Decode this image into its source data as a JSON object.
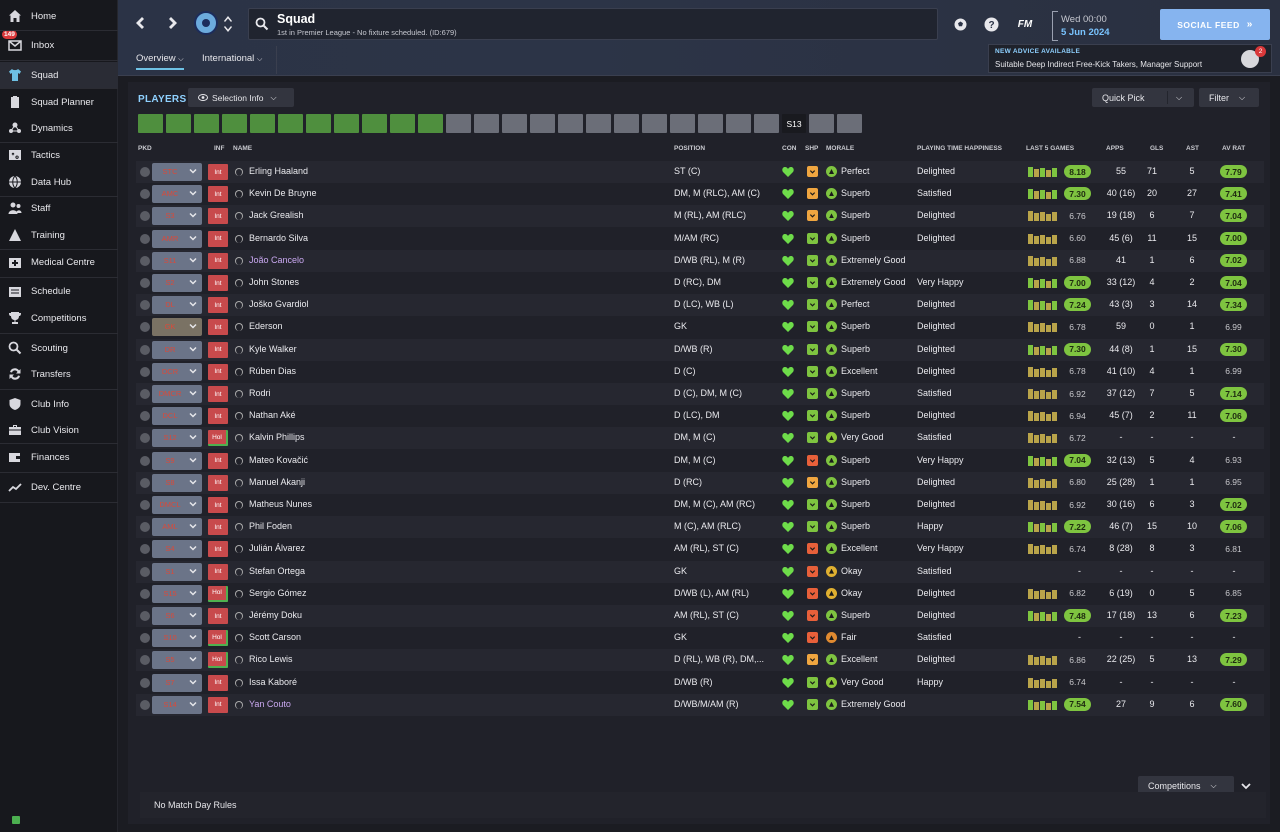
{
  "nav": {
    "items": [
      {
        "label": "Home",
        "icon": "home-icon"
      },
      {
        "label": "Inbox",
        "icon": "inbox-icon",
        "badge": "149"
      },
      {
        "label": "Squad",
        "icon": "shirt-icon",
        "active": true
      },
      {
        "label": "Squad Planner",
        "icon": "clipboard-icon"
      },
      {
        "label": "Dynamics",
        "icon": "dynamics-icon"
      },
      {
        "label": "Tactics",
        "icon": "tactics-board-icon"
      },
      {
        "label": "Data Hub",
        "icon": "globe-icon"
      },
      {
        "label": "Staff",
        "icon": "staff-icon"
      },
      {
        "label": "Training",
        "icon": "training-icon"
      },
      {
        "label": "Medical Centre",
        "icon": "medical-icon"
      },
      {
        "label": "Schedule",
        "icon": "calendar-icon"
      },
      {
        "label": "Competitions",
        "icon": "trophy-icon"
      },
      {
        "label": "Scouting",
        "icon": "search-icon"
      },
      {
        "label": "Transfers",
        "icon": "transfer-icon"
      },
      {
        "label": "Club Info",
        "icon": "shield-icon"
      },
      {
        "label": "Club Vision",
        "icon": "briefcase-icon"
      },
      {
        "label": "Finances",
        "icon": "wallet-icon"
      },
      {
        "label": "Dev. Centre",
        "icon": "development-icon"
      }
    ]
  },
  "header": {
    "title": "Squad",
    "subtitle": "1st in Premier League - No fixture scheduled. (ID:679)",
    "tabs": [
      "Overview",
      "International"
    ],
    "fm_label": "FM",
    "date_day": "Wed 00:00",
    "date_date": "5 Jun 2024",
    "social_feed": "SOCIAL FEED",
    "advice_title": "NEW ADVICE AVAILABLE",
    "advice_text": "Suitable Deep Indirect Free-Kick Takers, Manager Support",
    "advice_badge": "2"
  },
  "toolbar": {
    "players_label": "PLAYERS",
    "selection_info": "Selection Info",
    "quick_pick": "Quick Pick",
    "filter": "Filter",
    "selected_chip": "S13"
  },
  "columns": {
    "pkd": "PKD",
    "inf": "INF",
    "name": "NAME",
    "position": "POSITION",
    "con": "CON",
    "shp": "SHP",
    "morale": "MORALE",
    "pth": "PLAYING TIME HAPPINESS",
    "last5": "LAST 5 GAMES",
    "apps": "APPS",
    "gls": "GLS",
    "ast": "AST",
    "avrat": "AV RAT"
  },
  "players": [
    {
      "pkd": "STC",
      "inf": "Int",
      "name": "Erling Haaland",
      "position": "ST (C)",
      "morale": "Perfect",
      "pth": "Delighted",
      "last5": "8.18",
      "apps": "55",
      "gls": "71",
      "ast": "5",
      "avrat": "7.79"
    },
    {
      "pkd": "AMC",
      "inf": "Int",
      "name": "Kevin De Bruyne",
      "position": "DM, M (RLC), AM (C)",
      "morale": "Superb",
      "pth": "Satisfied",
      "last5": "7.30",
      "apps": "40 (16)",
      "gls": "20",
      "ast": "27",
      "avrat": "7.41"
    },
    {
      "pkd": "S3",
      "inf": "Int",
      "name": "Jack Grealish",
      "position": "M (RL), AM (RLC)",
      "morale": "Superb",
      "pth": "Delighted",
      "last5": "6.76",
      "apps": "19 (18)",
      "gls": "6",
      "ast": "7",
      "avrat": "7.04"
    },
    {
      "pkd": "AMR",
      "inf": "Int",
      "name": "Bernardo Silva",
      "position": "M/AM (RC)",
      "morale": "Superb",
      "pth": "Delighted",
      "last5": "6.60",
      "apps": "45 (6)",
      "gls": "11",
      "ast": "15",
      "avrat": "7.00"
    },
    {
      "pkd": "S11",
      "inf": "Int",
      "name": "João Cancelo",
      "position": "D/WB (RL), M (R)",
      "morale": "Extremely Good",
      "pth": "",
      "last5": "6.88",
      "apps": "41",
      "gls": "1",
      "ast": "6",
      "avrat": "7.02",
      "loan": true
    },
    {
      "pkd": "S2",
      "inf": "Int",
      "name": "John Stones",
      "position": "D (RC), DM",
      "morale": "Extremely Good",
      "pth": "Very Happy",
      "last5": "7.00",
      "apps": "33 (12)",
      "gls": "4",
      "ast": "2",
      "avrat": "7.04"
    },
    {
      "pkd": "DL",
      "inf": "Int",
      "name": "Joško Gvardiol",
      "position": "D (LC), WB (L)",
      "morale": "Perfect",
      "pth": "Delighted",
      "last5": "7.24",
      "apps": "43 (3)",
      "gls": "3",
      "ast": "14",
      "avrat": "7.34"
    },
    {
      "pkd": "GK",
      "inf": "Int",
      "name": "Ederson",
      "position": "GK",
      "morale": "Superb",
      "pth": "Delighted",
      "last5": "6.78",
      "apps": "59",
      "gls": "0",
      "ast": "1",
      "avrat": "6.99"
    },
    {
      "pkd": "DR",
      "inf": "Int",
      "name": "Kyle Walker",
      "position": "D/WB (R)",
      "morale": "Superb",
      "pth": "Delighted",
      "last5": "7.30",
      "apps": "44 (8)",
      "gls": "1",
      "ast": "15",
      "avrat": "7.30"
    },
    {
      "pkd": "DCR",
      "inf": "Int",
      "name": "Rúben Dias",
      "position": "D (C)",
      "morale": "Excellent",
      "pth": "Delighted",
      "last5": "6.78",
      "apps": "41 (10)",
      "gls": "4",
      "ast": "1",
      "avrat": "6.99"
    },
    {
      "pkd": "DMCR",
      "inf": "Int",
      "name": "Rodri",
      "position": "D (C), DM, M (C)",
      "morale": "Superb",
      "pth": "Satisfied",
      "last5": "6.92",
      "apps": "37 (12)",
      "gls": "7",
      "ast": "5",
      "avrat": "7.14"
    },
    {
      "pkd": "DCL",
      "inf": "Int",
      "name": "Nathan Aké",
      "position": "D (LC), DM",
      "morale": "Superb",
      "pth": "Delighted",
      "last5": "6.94",
      "apps": "45 (7)",
      "gls": "2",
      "ast": "11",
      "avrat": "7.06"
    },
    {
      "pkd": "S12",
      "inf": "Hol",
      "name": "Kalvin Phillips",
      "position": "DM, M (C)",
      "morale": "Very Good",
      "pth": "Satisfied",
      "last5": "6.72",
      "apps": "-",
      "gls": "-",
      "ast": "-",
      "avrat": "-"
    },
    {
      "pkd": "S9",
      "inf": "Int",
      "name": "Mateo Kovačić",
      "position": "DM, M (C)",
      "morale": "Superb",
      "pth": "Very Happy",
      "last5": "7.04",
      "apps": "32 (13)",
      "gls": "5",
      "ast": "4",
      "avrat": "6.93"
    },
    {
      "pkd": "S8",
      "inf": "Int",
      "name": "Manuel Akanji",
      "position": "D (RC)",
      "morale": "Superb",
      "pth": "Delighted",
      "last5": "6.80",
      "apps": "25 (28)",
      "gls": "1",
      "ast": "1",
      "avrat": "6.95"
    },
    {
      "pkd": "DMCL",
      "inf": "Int",
      "name": "Matheus Nunes",
      "position": "DM, M (C), AM (RC)",
      "morale": "Superb",
      "pth": "Delighted",
      "last5": "6.92",
      "apps": "30 (16)",
      "gls": "6",
      "ast": "3",
      "avrat": "7.02"
    },
    {
      "pkd": "AML",
      "inf": "Int",
      "name": "Phil Foden",
      "position": "M (C), AM (RLC)",
      "morale": "Superb",
      "pth": "Happy",
      "last5": "7.22",
      "apps": "46 (7)",
      "gls": "15",
      "ast": "10",
      "avrat": "7.06"
    },
    {
      "pkd": "S4",
      "inf": "Int",
      "name": "Julián Álvarez",
      "position": "AM (RL), ST (C)",
      "morale": "Excellent",
      "pth": "Very Happy",
      "last5": "6.74",
      "apps": "8 (28)",
      "gls": "8",
      "ast": "3",
      "avrat": "6.81"
    },
    {
      "pkd": "S1",
      "inf": "Int",
      "name": "Stefan Ortega",
      "position": "GK",
      "morale": "Okay",
      "pth": "Satisfied",
      "last5": "-",
      "apps": "-",
      "gls": "-",
      "ast": "-",
      "avrat": "-"
    },
    {
      "pkd": "S15",
      "inf": "Hol",
      "name": "Sergio Gómez",
      "position": "D/WB (L), AM (RL)",
      "morale": "Okay",
      "pth": "Delighted",
      "last5": "6.82",
      "apps": "6 (19)",
      "gls": "0",
      "ast": "5",
      "avrat": "6.85"
    },
    {
      "pkd": "S6",
      "inf": "Int",
      "name": "Jérémy Doku",
      "position": "AM (RL), ST (C)",
      "morale": "Superb",
      "pth": "Delighted",
      "last5": "7.48",
      "apps": "17 (18)",
      "gls": "13",
      "ast": "6",
      "avrat": "7.23"
    },
    {
      "pkd": "S10",
      "inf": "Hol",
      "name": "Scott Carson",
      "position": "GK",
      "morale": "Fair",
      "pth": "Satisfied",
      "last5": "-",
      "apps": "-",
      "gls": "-",
      "ast": "-",
      "avrat": "-"
    },
    {
      "pkd": "S5",
      "inf": "Hol",
      "name": "Rico Lewis",
      "position": "D (RL), WB (R), DM,...",
      "morale": "Excellent",
      "pth": "Delighted",
      "last5": "6.86",
      "apps": "22 (25)",
      "gls": "5",
      "ast": "13",
      "avrat": "7.29"
    },
    {
      "pkd": "S7",
      "inf": "Int",
      "name": "Issa Kaboré",
      "position": "D/WB (R)",
      "morale": "Very Good",
      "pth": "Happy",
      "last5": "6.74",
      "apps": "-",
      "gls": "-",
      "ast": "-",
      "avrat": "-"
    },
    {
      "pkd": "S14",
      "inf": "Int",
      "name": "Yan Couto",
      "position": "D/WB/M/AM (R)",
      "morale": "Extremely Good",
      "pth": "",
      "last5": "7.54",
      "apps": "27",
      "gls": "9",
      "ast": "6",
      "avrat": "7.60",
      "loan": true
    }
  ],
  "footer": {
    "no_rules": "No Match Day Rules",
    "competitions": "Competitions"
  },
  "colors": {
    "accent": "#8fd1ff",
    "rating_green": "#7ec440",
    "social_feed": "#86b4ef"
  }
}
